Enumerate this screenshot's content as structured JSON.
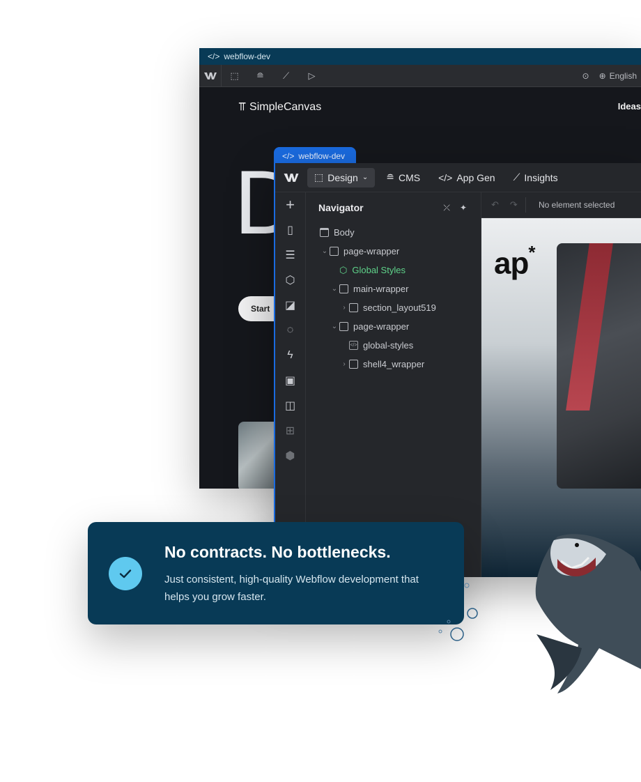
{
  "back_window": {
    "tab_label": "webflow-dev",
    "language": "English",
    "site": {
      "logo_text": "SimpleCanvas",
      "nav_link": "Ideas",
      "hero_letter": "D",
      "cta_label": "Start"
    }
  },
  "front_window": {
    "tab_label": "webflow-dev",
    "toolbar": {
      "design": "Design",
      "cms": "CMS",
      "app_gen": "App Gen",
      "insights": "Insights"
    },
    "navigator": {
      "title": "Navigator",
      "items": [
        {
          "label": "Body"
        },
        {
          "label": "page-wrapper"
        },
        {
          "label": "Global Styles"
        },
        {
          "label": "main-wrapper"
        },
        {
          "label": "section_layout519"
        },
        {
          "label": "page-wrapper"
        },
        {
          "label": "global-styles"
        },
        {
          "label": "shell4_wrapper"
        }
      ]
    },
    "canvas": {
      "selection_status": "No element selected",
      "logo_text": "ap",
      "logo_mark": "*"
    }
  },
  "card": {
    "title": "No contracts. No bottlenecks.",
    "body": "Just consistent, high-quality Webflow development that helps you grow faster.",
    "accent_color": "#5fc9ef",
    "background_color": "#083a56"
  },
  "icons": [
    "webflow-logo-icon",
    "cursor-icon",
    "database-icon",
    "chart-icon",
    "play-icon",
    "preview-icon",
    "globe-icon",
    "chevron-down-icon",
    "code-icon",
    "plus-icon",
    "page-icon",
    "navigator-icon",
    "cube-icon",
    "style-icon",
    "drops-icon",
    "lightning-icon",
    "image-icon",
    "book-icon",
    "apps-icon",
    "collapse-icon",
    "pin-icon",
    "undo-icon",
    "redo-icon",
    "check-icon"
  ]
}
